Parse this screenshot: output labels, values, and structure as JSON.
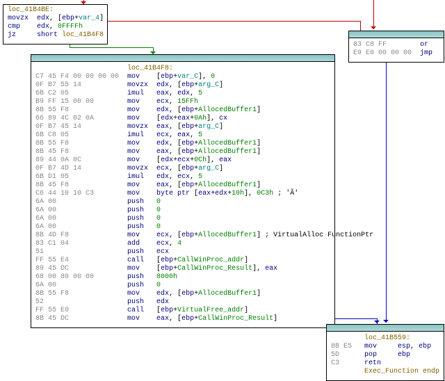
{
  "node_top": {
    "label": "loc_41B4BE:",
    "rows": [
      {
        "hex": "",
        "mn": "movzx",
        "ops": [
          {
            "t": "edx",
            "c": "tok-navy"
          },
          {
            "t": ", [",
            "c": ""
          },
          {
            "t": "ebp",
            "c": "tok-navy"
          },
          {
            "t": "+",
            "c": ""
          },
          {
            "t": "var_4",
            "c": "tok-teal"
          },
          {
            "t": "]",
            "c": ""
          }
        ]
      },
      {
        "hex": "",
        "mn": "cmp",
        "ops": [
          {
            "t": "edx",
            "c": "tok-navy"
          },
          {
            "t": ", ",
            "c": ""
          },
          {
            "t": "0FFFFh",
            "c": "tok-green"
          }
        ]
      },
      {
        "hex": "",
        "mn": "jz",
        "ops": [
          {
            "t": "short",
            "c": "tok-navy"
          },
          {
            "t": " ",
            "c": ""
          },
          {
            "t": "loc_41B4F8",
            "c": "tok-brown"
          }
        ]
      }
    ]
  },
  "node_right": {
    "rows": [
      {
        "hex": "83 C8 FF",
        "mn": "or",
        "ops": []
      },
      {
        "hex": "E9 E0 00 00 00",
        "mn": "jmp",
        "ops": []
      }
    ]
  },
  "node_main": {
    "label": "loc_41B4F8:",
    "rows": [
      {
        "hex": "C7 45 F4 00 00 00 00",
        "mn": "mov",
        "ops": [
          {
            "t": "[",
            "c": ""
          },
          {
            "t": "ebp",
            "c": "tok-navy"
          },
          {
            "t": "+",
            "c": ""
          },
          {
            "t": "var_C",
            "c": "tok-teal"
          },
          {
            "t": "], ",
            "c": ""
          },
          {
            "t": "0",
            "c": "tok-green"
          }
        ]
      },
      {
        "hex": "0F B7 55 14",
        "mn": "movzx",
        "ops": [
          {
            "t": "edx",
            "c": "tok-navy"
          },
          {
            "t": ", [",
            "c": ""
          },
          {
            "t": "ebp",
            "c": "tok-navy"
          },
          {
            "t": "+",
            "c": ""
          },
          {
            "t": "arg_C",
            "c": "tok-teal"
          },
          {
            "t": "]",
            "c": ""
          }
        ]
      },
      {
        "hex": "6B C2 05",
        "mn": "imul",
        "ops": [
          {
            "t": "eax",
            "c": "tok-navy"
          },
          {
            "t": ", ",
            "c": ""
          },
          {
            "t": "edx",
            "c": "tok-navy"
          },
          {
            "t": ", ",
            "c": ""
          },
          {
            "t": "5",
            "c": "tok-green"
          }
        ]
      },
      {
        "hex": "B9 FF 15 00 00",
        "mn": "mov",
        "ops": [
          {
            "t": "ecx",
            "c": "tok-navy"
          },
          {
            "t": ", ",
            "c": ""
          },
          {
            "t": "15FFh",
            "c": "tok-green"
          }
        ]
      },
      {
        "hex": "8B 55 F8",
        "mn": "mov",
        "ops": [
          {
            "t": "edx",
            "c": "tok-navy"
          },
          {
            "t": ", [",
            "c": ""
          },
          {
            "t": "ebp",
            "c": "tok-navy"
          },
          {
            "t": "+",
            "c": ""
          },
          {
            "t": "AllocedBuffer1",
            "c": "tok-green"
          },
          {
            "t": "]",
            "c": ""
          }
        ]
      },
      {
        "hex": "66 89 4C 02 0A",
        "mn": "mov",
        "ops": [
          {
            "t": "[",
            "c": ""
          },
          {
            "t": "edx",
            "c": "tok-navy"
          },
          {
            "t": "+",
            "c": ""
          },
          {
            "t": "eax",
            "c": "tok-navy"
          },
          {
            "t": "+",
            "c": ""
          },
          {
            "t": "0Ah",
            "c": "tok-green"
          },
          {
            "t": "], ",
            "c": ""
          },
          {
            "t": "cx",
            "c": "tok-navy"
          }
        ]
      },
      {
        "hex": "0F B7 45 14",
        "mn": "movzx",
        "ops": [
          {
            "t": "eax",
            "c": "tok-navy"
          },
          {
            "t": ", [",
            "c": ""
          },
          {
            "t": "ebp",
            "c": "tok-navy"
          },
          {
            "t": "+",
            "c": ""
          },
          {
            "t": "arg_C",
            "c": "tok-teal"
          },
          {
            "t": "]",
            "c": ""
          }
        ]
      },
      {
        "hex": "6B C8 05",
        "mn": "imul",
        "ops": [
          {
            "t": "ecx",
            "c": "tok-navy"
          },
          {
            "t": ", ",
            "c": ""
          },
          {
            "t": "eax",
            "c": "tok-navy"
          },
          {
            "t": ", ",
            "c": ""
          },
          {
            "t": "5",
            "c": "tok-green"
          }
        ]
      },
      {
        "hex": "8B 55 F8",
        "mn": "mov",
        "ops": [
          {
            "t": "edx",
            "c": "tok-navy"
          },
          {
            "t": ", [",
            "c": ""
          },
          {
            "t": "ebp",
            "c": "tok-navy"
          },
          {
            "t": "+",
            "c": ""
          },
          {
            "t": "AllocedBuffer1",
            "c": "tok-green"
          },
          {
            "t": "]",
            "c": ""
          }
        ]
      },
      {
        "hex": "8B 45 F8",
        "mn": "mov",
        "ops": [
          {
            "t": "eax",
            "c": "tok-navy"
          },
          {
            "t": ", [",
            "c": ""
          },
          {
            "t": "ebp",
            "c": "tok-navy"
          },
          {
            "t": "+",
            "c": ""
          },
          {
            "t": "AllocedBuffer1",
            "c": "tok-green"
          },
          {
            "t": "]",
            "c": ""
          }
        ]
      },
      {
        "hex": "89 44 0A 0C",
        "mn": "mov",
        "ops": [
          {
            "t": "[",
            "c": ""
          },
          {
            "t": "edx",
            "c": "tok-navy"
          },
          {
            "t": "+",
            "c": ""
          },
          {
            "t": "ecx",
            "c": "tok-navy"
          },
          {
            "t": "+",
            "c": ""
          },
          {
            "t": "0Ch",
            "c": "tok-green"
          },
          {
            "t": "], ",
            "c": ""
          },
          {
            "t": "eax",
            "c": "tok-navy"
          }
        ]
      },
      {
        "hex": "0F B7 4D 14",
        "mn": "movzx",
        "ops": [
          {
            "t": "ecx",
            "c": "tok-navy"
          },
          {
            "t": ", [",
            "c": ""
          },
          {
            "t": "ebp",
            "c": "tok-navy"
          },
          {
            "t": "+",
            "c": ""
          },
          {
            "t": "arg_C",
            "c": "tok-teal"
          },
          {
            "t": "]",
            "c": ""
          }
        ]
      },
      {
        "hex": "6B D1 05",
        "mn": "imul",
        "ops": [
          {
            "t": "edx",
            "c": "tok-navy"
          },
          {
            "t": ", ",
            "c": ""
          },
          {
            "t": "ecx",
            "c": "tok-navy"
          },
          {
            "t": ", ",
            "c": ""
          },
          {
            "t": "5",
            "c": "tok-green"
          }
        ]
      },
      {
        "hex": "8B 45 F8",
        "mn": "mov",
        "ops": [
          {
            "t": "eax",
            "c": "tok-navy"
          },
          {
            "t": ", [",
            "c": ""
          },
          {
            "t": "ebp",
            "c": "tok-navy"
          },
          {
            "t": "+",
            "c": ""
          },
          {
            "t": "AllocedBuffer1",
            "c": "tok-green"
          },
          {
            "t": "]",
            "c": ""
          }
        ]
      },
      {
        "hex": "C6 44 10 10 C3",
        "mn": "mov",
        "ops": [
          {
            "t": "byte ptr",
            "c": "tok-navy"
          },
          {
            "t": " [",
            "c": ""
          },
          {
            "t": "eax",
            "c": "tok-navy"
          },
          {
            "t": "+",
            "c": ""
          },
          {
            "t": "edx",
            "c": "tok-navy"
          },
          {
            "t": "+",
            "c": ""
          },
          {
            "t": "10h",
            "c": "tok-green"
          },
          {
            "t": "], ",
            "c": ""
          },
          {
            "t": "0C3h",
            "c": "tok-green"
          },
          {
            "t": " ; 'Ã'",
            "c": ""
          }
        ]
      },
      {
        "hex": "6A 00",
        "mn": "push",
        "ops": [
          {
            "t": "0",
            "c": "tok-green"
          }
        ]
      },
      {
        "hex": "6A 00",
        "mn": "push",
        "ops": [
          {
            "t": "0",
            "c": "tok-green"
          }
        ]
      },
      {
        "hex": "6A 00",
        "mn": "push",
        "ops": [
          {
            "t": "0",
            "c": "tok-green"
          }
        ]
      },
      {
        "hex": "6A 00",
        "mn": "push",
        "ops": [
          {
            "t": "0",
            "c": "tok-green"
          }
        ]
      },
      {
        "hex": "8B 4D F8",
        "mn": "mov",
        "ops": [
          {
            "t": "ecx",
            "c": "tok-navy"
          },
          {
            "t": ", [",
            "c": ""
          },
          {
            "t": "ebp",
            "c": "tok-navy"
          },
          {
            "t": "+",
            "c": ""
          },
          {
            "t": "AllocedBuffer1",
            "c": "tok-green"
          },
          {
            "t": "] ; VirtualAlloc FunctionPtr",
            "c": ""
          }
        ]
      },
      {
        "hex": "83 C1 04",
        "mn": "add",
        "ops": [
          {
            "t": "ecx",
            "c": "tok-navy"
          },
          {
            "t": ", ",
            "c": ""
          },
          {
            "t": "4",
            "c": "tok-green"
          }
        ]
      },
      {
        "hex": "51",
        "mn": "push",
        "ops": [
          {
            "t": "ecx",
            "c": "tok-navy"
          }
        ]
      },
      {
        "hex": "FF 55 E4",
        "mn": "call",
        "ops": [
          {
            "t": "[",
            "c": ""
          },
          {
            "t": "ebp",
            "c": "tok-navy"
          },
          {
            "t": "+",
            "c": ""
          },
          {
            "t": "CallWinProc_addr",
            "c": "tok-green"
          },
          {
            "t": "]",
            "c": ""
          }
        ]
      },
      {
        "hex": "89 45 DC",
        "mn": "mov",
        "ops": [
          {
            "t": "[",
            "c": ""
          },
          {
            "t": "ebp",
            "c": "tok-navy"
          },
          {
            "t": "+",
            "c": ""
          },
          {
            "t": "CallWinProc_Result",
            "c": "tok-green"
          },
          {
            "t": "], ",
            "c": ""
          },
          {
            "t": "eax",
            "c": "tok-navy"
          }
        ]
      },
      {
        "hex": "68 00 80 00 00",
        "mn": "push",
        "ops": [
          {
            "t": "8000h",
            "c": "tok-green"
          }
        ]
      },
      {
        "hex": "6A 00",
        "mn": "push",
        "ops": [
          {
            "t": "0",
            "c": "tok-green"
          }
        ]
      },
      {
        "hex": "8B 55 F8",
        "mn": "mov",
        "ops": [
          {
            "t": "edx",
            "c": "tok-navy"
          },
          {
            "t": ", [",
            "c": ""
          },
          {
            "t": "ebp",
            "c": "tok-navy"
          },
          {
            "t": "+",
            "c": ""
          },
          {
            "t": "AllocedBuffer1",
            "c": "tok-green"
          },
          {
            "t": "]",
            "c": ""
          }
        ]
      },
      {
        "hex": "52",
        "mn": "push",
        "ops": [
          {
            "t": "edx",
            "c": "tok-navy"
          }
        ]
      },
      {
        "hex": "FF 55 E0",
        "mn": "call",
        "ops": [
          {
            "t": "[",
            "c": ""
          },
          {
            "t": "ebp",
            "c": "tok-navy"
          },
          {
            "t": "+",
            "c": ""
          },
          {
            "t": "VirtualFree_addr",
            "c": "tok-green"
          },
          {
            "t": "]",
            "c": ""
          }
        ]
      },
      {
        "hex": "8B 45 DC",
        "mn": "mov",
        "ops": [
          {
            "t": "eax",
            "c": "tok-navy"
          },
          {
            "t": ", [",
            "c": ""
          },
          {
            "t": "ebp",
            "c": "tok-navy"
          },
          {
            "t": "+",
            "c": ""
          },
          {
            "t": "CallWinProc_Result",
            "c": "tok-green"
          },
          {
            "t": "]",
            "c": ""
          }
        ]
      }
    ]
  },
  "node_end": {
    "label": "loc_41B559:",
    "rows": [
      {
        "hex": "8B E5",
        "mn": "mov",
        "ops": [
          {
            "t": "esp",
            "c": "tok-navy"
          },
          {
            "t": ", ",
            "c": ""
          },
          {
            "t": "ebp",
            "c": "tok-navy"
          }
        ]
      },
      {
        "hex": "5D",
        "mn": "pop",
        "ops": [
          {
            "t": "ebp",
            "c": "tok-navy"
          }
        ]
      },
      {
        "hex": "C3",
        "mn": "retn",
        "ops": []
      }
    ],
    "endp": "Exec_Function endp"
  }
}
